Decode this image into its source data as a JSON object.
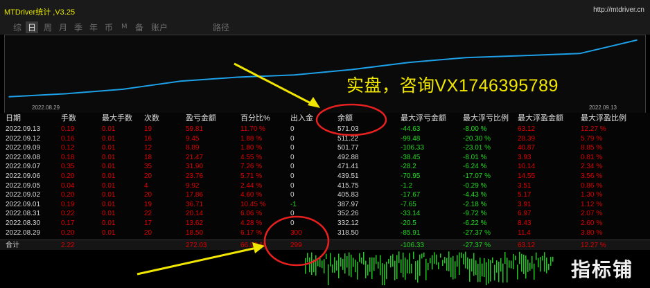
{
  "window": {
    "title": "MTDriver统计 ,V3.25",
    "url": "http://mtdriver.cn"
  },
  "tabs": [
    {
      "label": "综",
      "active": false
    },
    {
      "label": "日",
      "active": true
    },
    {
      "label": "周",
      "active": false
    },
    {
      "label": "月",
      "active": false
    },
    {
      "label": "季",
      "active": false
    },
    {
      "label": "年",
      "active": false
    },
    {
      "label": "币",
      "active": false
    },
    {
      "label": "M",
      "active": false
    },
    {
      "label": "备",
      "active": false
    },
    {
      "label": "账户",
      "active": false
    },
    {
      "label": "路径",
      "active": false
    }
  ],
  "promo_text": "实盘，咨询VX1746395789",
  "chart_data": {
    "type": "line",
    "x_start_label": "2022.08.29",
    "x_end_label": "2022.09.13",
    "x": [
      "2022.08.29",
      "2022.08.30",
      "2022.08.31",
      "2022.09.01",
      "2022.09.02",
      "2022.09.05",
      "2022.09.06",
      "2022.09.07",
      "2022.09.08",
      "2022.09.09",
      "2022.09.12",
      "2022.09.13"
    ],
    "series": [
      {
        "values": [
          318.5,
          332.12,
          352.26,
          387.97,
          405.83,
          415.75,
          439.51,
          471.41,
          492.88,
          501.77,
          511.22,
          571.03
        ],
        "color": "#1ea0e8"
      }
    ],
    "ylim": [
      290,
      580
    ]
  },
  "table": {
    "headers": [
      "日期",
      "手数",
      "最大手数",
      "次数",
      "盈亏金额",
      "百分比%",
      "出入金",
      "余额",
      "最大浮亏金额",
      "最大浮亏比例",
      "最大浮盈金额",
      "最大浮盈比例"
    ],
    "rows": [
      [
        "2022.09.13",
        "0.19",
        "0.01",
        "19",
        "59.81",
        "11.70 %",
        "0",
        "571.03",
        "-44.63",
        "-8.00 %",
        "63.12",
        "12.27 %"
      ],
      [
        "2022.09.12",
        "0.16",
        "0.01",
        "16",
        "9.45",
        "1.88 %",
        "0",
        "511.22",
        "-99.48",
        "-20.30 %",
        "28.39",
        "5.79 %"
      ],
      [
        "2022.09.09",
        "0.12",
        "0.01",
        "12",
        "8.89",
        "1.80 %",
        "0",
        "501.77",
        "-106.33",
        "-23.01 %",
        "40.87",
        "8.85 %"
      ],
      [
        "2022.09.08",
        "0.18",
        "0.01",
        "18",
        "21.47",
        "4.55 %",
        "0",
        "492.88",
        "-38.45",
        "-8.01 %",
        "3.93",
        "0.81 %"
      ],
      [
        "2022.09.07",
        "0.35",
        "0.01",
        "35",
        "31.90",
        "7.26 %",
        "0",
        "471.41",
        "-28.2",
        "-6.24 %",
        "10.14",
        "2.34 %"
      ],
      [
        "2022.09.06",
        "0.20",
        "0.01",
        "20",
        "23.76",
        "5.71 %",
        "0",
        "439.51",
        "-70.95",
        "-17.07 %",
        "14.55",
        "3.56 %"
      ],
      [
        "2022.09.05",
        "0.04",
        "0.01",
        "4",
        "9.92",
        "2.44 %",
        "0",
        "415.75",
        "-1.2",
        "-0.29 %",
        "3.51",
        "0.86 %"
      ],
      [
        "2022.09.02",
        "0.20",
        "0.01",
        "20",
        "17.86",
        "4.60 %",
        "0",
        "405.83",
        "-17.67",
        "-4.43 %",
        "5.17",
        "1.30 %"
      ],
      [
        "2022.09.01",
        "0.19",
        "0.01",
        "19",
        "36.71",
        "10.45 %",
        "-1",
        "387.97",
        "-7.65",
        "-2.18 %",
        "3.91",
        "1.12 %"
      ],
      [
        "2022.08.31",
        "0.22",
        "0.01",
        "22",
        "20.14",
        "6.06 %",
        "0",
        "352.26",
        "-33.14",
        "-9.72 %",
        "6.97",
        "2.07 %"
      ],
      [
        "2022.08.30",
        "0.17",
        "0.01",
        "17",
        "13.62",
        "4.28 %",
        "0",
        "332.12",
        "-20.5",
        "-6.22 %",
        "8.43",
        "2.60 %"
      ],
      [
        "2022.08.29",
        "0.20",
        "0.01",
        "20",
        "18.50",
        "6.17 %",
        "300",
        "318.50",
        "-85.91",
        "-27.37 %",
        "11.4",
        "3.80 %"
      ]
    ],
    "total": [
      "合计",
      "2.22",
      "",
      "",
      "272.03",
      "66.92 %",
      "299",
      "",
      "-106.33",
      "-27.37 %",
      "63.12",
      "12.27 %"
    ]
  },
  "logo_text": "指标铺",
  "colors": {
    "profit": "#e00000",
    "loss": "#22d822",
    "neutral": "#d8d8d8",
    "equity_line": "#1ea0e8",
    "promo": "#f2e800",
    "annotation": "#e82020",
    "arrow": "#f0e600"
  }
}
